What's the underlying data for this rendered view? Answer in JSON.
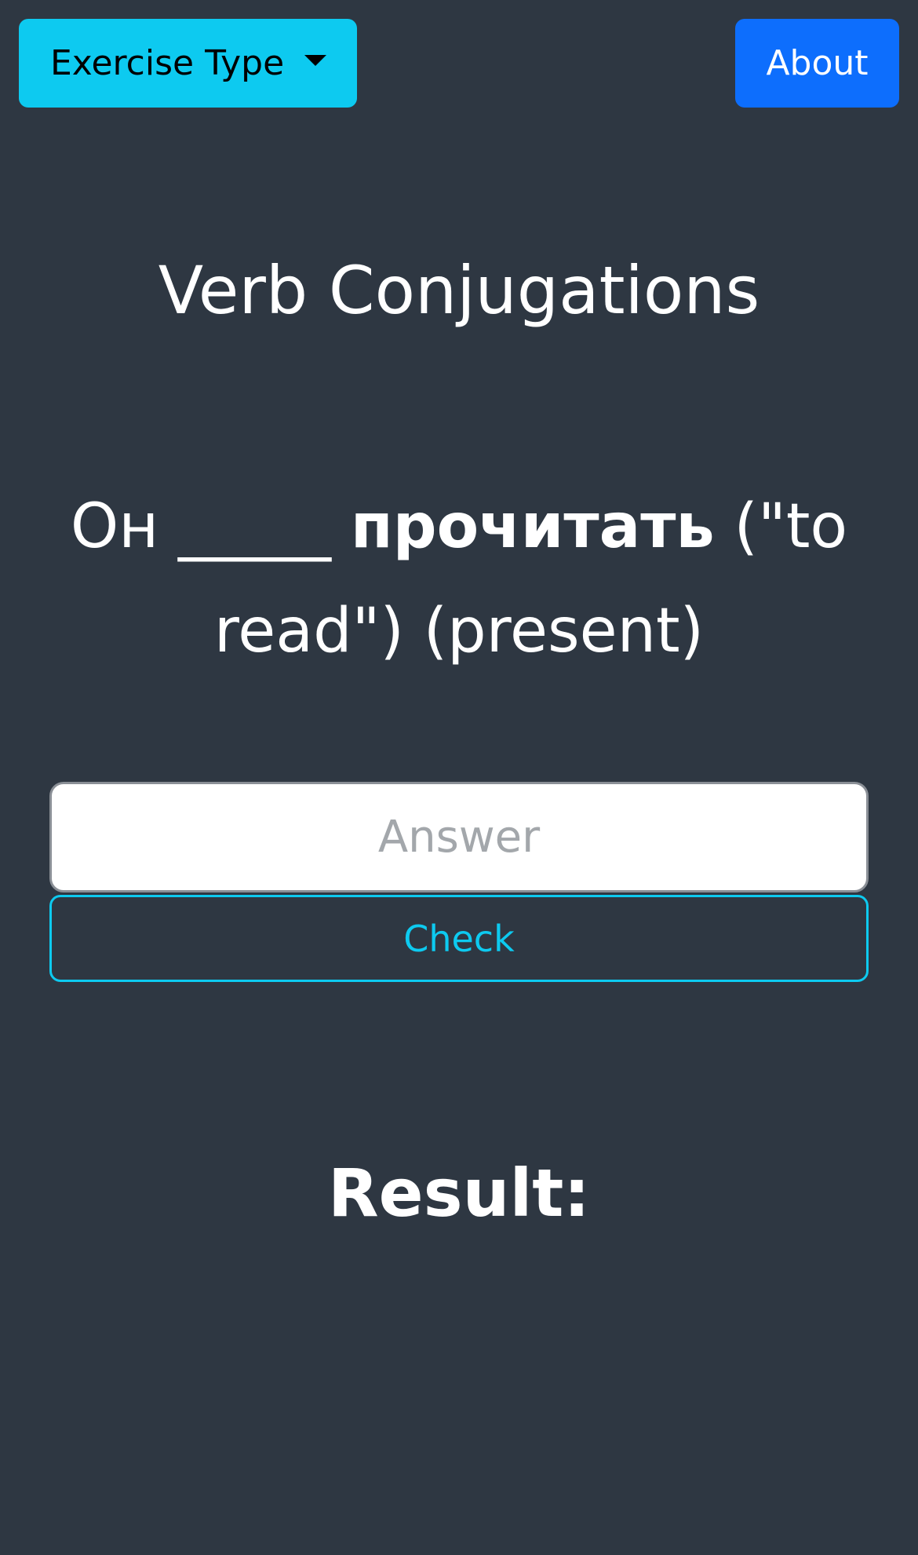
{
  "navbar": {
    "dropdown_label": "Exercise Type",
    "dropdown_icon": "caret-down-icon",
    "about_label": "About",
    "colors": {
      "dropdown_bg": "#0dcaf0",
      "about_bg": "#0d6efd"
    }
  },
  "main": {
    "title": "Verb Conjugations",
    "prompt": {
      "subject": "Он",
      "blank": "_____",
      "verb": "прочитать",
      "translation": "(\"to read\")",
      "tense": "(present)"
    },
    "answer": {
      "placeholder": "Answer",
      "value": ""
    },
    "check_label": "Check",
    "result_label": "Result:"
  },
  "colors": {
    "background": "#2e3742",
    "accent": "#0dcaf0"
  }
}
